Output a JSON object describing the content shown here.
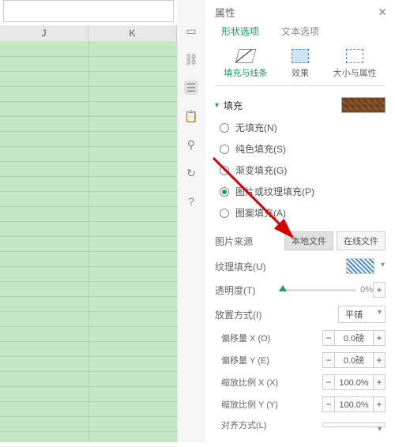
{
  "sheet": {
    "cols": [
      "J",
      "K"
    ]
  },
  "panel": {
    "title": "属性",
    "tabs": {
      "shape": "形状选项",
      "text": "文本选项"
    },
    "subtabs": {
      "fill": "填充与线条",
      "effect": "效果",
      "size": "大小与属性"
    }
  },
  "fill": {
    "section": "填充",
    "options": {
      "none": "无填充(N)",
      "solid": "纯色填充(S)",
      "gradient": "渐变填充(G)",
      "picture": "图片或纹理填充(P)",
      "pattern": "图案填充(A)"
    },
    "source_label": "图片来源",
    "source_local": "本地文件",
    "source_online": "在线文件",
    "texture_label": "纹理填充(U)",
    "opacity_label": "透明度(T)",
    "opacity_value": "0%",
    "tile_label": "放置方式(I)",
    "tile_value": "平铺",
    "offset_x": "偏移量 X (O)",
    "offset_y": "偏移量 Y (E)",
    "scale_x": "缩放比例 X (X)",
    "scale_y": "缩放比例 Y (Y)",
    "align": "对齐方式(L)",
    "offset_val": "0.0磅",
    "scale_val": "100.0%"
  }
}
